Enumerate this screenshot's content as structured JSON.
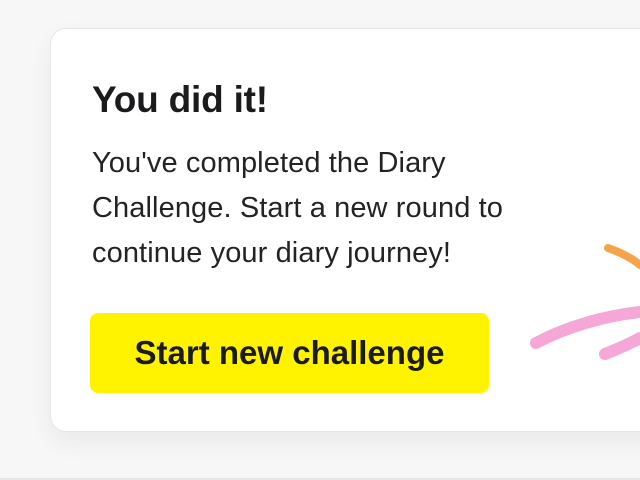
{
  "card": {
    "title": "You did it!",
    "message": "You've completed the Diary Challenge. Start a new round to continue your diary journey!",
    "button_label": "Start new challenge"
  },
  "colors": {
    "button_background": "#fff300",
    "doodle_orange": "#f6a34a",
    "doodle_pink": "#f5a7d8"
  }
}
